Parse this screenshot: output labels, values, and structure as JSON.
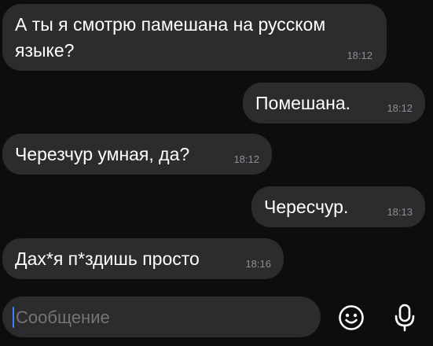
{
  "messages": [
    {
      "id": "m1",
      "direction": "incoming",
      "text": "А ты я смотрю памешана на русском\nязыке?",
      "time": "18:12"
    },
    {
      "id": "m2",
      "direction": "outgoing",
      "text": "Помешана.",
      "time": "18:12"
    },
    {
      "id": "m3",
      "direction": "incoming",
      "text": "Черезчур умная, да?",
      "time": "18:12"
    },
    {
      "id": "m4",
      "direction": "outgoing",
      "text": "Чересчур.",
      "time": "18:13"
    },
    {
      "id": "m5",
      "direction": "incoming",
      "text": "Дах*я п*здишь просто",
      "time": "18:16"
    }
  ],
  "composer": {
    "placeholder": "Сообщение",
    "emoji_icon": "smiley-face-icon",
    "mic_icon": "microphone-icon"
  },
  "colors": {
    "background": "#0d0d0d",
    "bubble": "#2c2c2e",
    "timestamp": "#8e8e93",
    "caret": "#3a82f7"
  }
}
